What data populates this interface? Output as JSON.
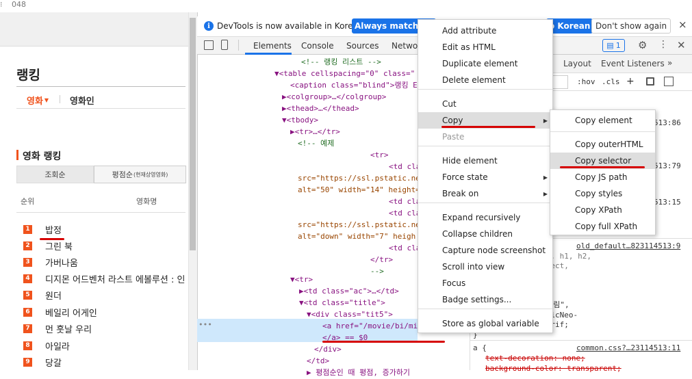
{
  "top_strip": {
    "dots": "⁝",
    "number": "048"
  },
  "left": {
    "page_title": "랭킹",
    "tabs": [
      {
        "label": "영화"
      },
      {
        "label": "영화인"
      }
    ],
    "section_title": "영화 랭킹",
    "sort_buttons": [
      {
        "label": "조회순"
      },
      {
        "label": "평점순",
        "sub": "(현재상영영화)"
      }
    ],
    "columns": {
      "rank": "순위",
      "movie": "영화명"
    },
    "rows": [
      {
        "rank": "1",
        "title": "밥정"
      },
      {
        "rank": "2",
        "title": "그린 북"
      },
      {
        "rank": "3",
        "title": "가버나움"
      },
      {
        "rank": "4",
        "title": "디지몬 어드벤처 라스트 에볼루션 : 인"
      },
      {
        "rank": "5",
        "title": "원더"
      },
      {
        "rank": "6",
        "title": "베일리 어게인"
      },
      {
        "rank": "7",
        "title": "먼 훗날 우리"
      },
      {
        "rank": "8",
        "title": "아일라"
      },
      {
        "rank": "9",
        "title": "당갈"
      }
    ]
  },
  "devtools": {
    "info_text": "DevTools is now available in Korean!",
    "btn_match": "Always match Ch",
    "btn_switch": "o Korean",
    "btn_dont_show": "Don't show again",
    "close": "×",
    "tabs": [
      "Elements",
      "Console",
      "Sources",
      "Networ"
    ],
    "badge_count": "1",
    "side_tabs": [
      "Layout",
      "Event Listeners",
      "»"
    ],
    "styles_toolbar": [
      ":hov",
      ".cls",
      "+"
    ],
    "dom_lines": [
      "<!-- 랭킹 리스트 -->",
      "▼<table cellspacing=\"0\" class=\"",
      "<caption class=\"blind\">랭킹 E",
      "▶<colgroup>…</colgroup>",
      "▶<thead>…</thead>",
      "▼<tbody>",
      "▶<tr>…</tr>",
      "<!-- 예제",
      "<tr>",
      "<td cla",
      "src=\"https://ssl.pstatic.ne",
      "alt=\"50\" width=\"14\" height=",
      "<td cla",
      "<td cla",
      "src=\"https://ssl.pstatic.ne",
      "alt=\"down\" width=\"7\" heigh",
      "<td cla",
      "</tr>",
      "-->",
      "▼<tr>",
      "▶<td class=\"ac\">…</td>",
      "▼<td class=\"title\">",
      "▼<div class=\"tit5\">",
      "<a href=\"/movie/bi/mi",
      "</a> == $0",
      "</div>",
      "</td>",
      "▶ 평점순인 때 평점, 증가하기"
    ],
    "styles_lines": [
      "513:86",
      "513:79",
      "513:15",
      "old_default…823114513:9",
      ", dl, dt, dd, a, h1, h2,",
      "orm, input, select,",
      ", legend, img {",
      "rmal;",
      "돌움\", Dotum, \"굴림\",",
      "ica,AppleSDGothicNeo-",
      "Gothic, Sans-serif;",
      "}",
      "common.css?…23114513:11",
      "a {",
      "text-decoration: none;",
      "background-color: transparent;"
    ],
    "dom_hover_dots": "•••"
  },
  "context_menu": {
    "items": [
      {
        "label": "Add attribute"
      },
      {
        "label": "Edit as HTML"
      },
      {
        "label": "Duplicate element"
      },
      {
        "label": "Delete element"
      },
      {
        "label": "Cut"
      },
      {
        "label": "Copy",
        "arrow": "▶"
      },
      {
        "label": "Paste"
      },
      {
        "label": "Hide element"
      },
      {
        "label": "Force state",
        "arrow": "▶"
      },
      {
        "label": "Break on",
        "arrow": "▶"
      },
      {
        "label": "Expand recursively"
      },
      {
        "label": "Collapse children"
      },
      {
        "label": "Capture node screenshot"
      },
      {
        "label": "Scroll into view"
      },
      {
        "label": "Focus"
      },
      {
        "label": "Badge settings..."
      },
      {
        "label": "Store as global variable"
      }
    ]
  },
  "submenu": {
    "items": [
      {
        "label": "Copy element"
      },
      {
        "label": "Copy outerHTML"
      },
      {
        "label": "Copy selector"
      },
      {
        "label": "Copy JS path"
      },
      {
        "label": "Copy styles"
      },
      {
        "label": "Copy XPath"
      },
      {
        "label": "Copy full XPath"
      }
    ]
  },
  "colors": {
    "accent_orange": "#f0531d",
    "devtools_blue": "#1a73e8",
    "annotation_red": "#d60000",
    "tag": "#881280",
    "attr": "#994500",
    "value": "#1a1aa6",
    "comment": "#236e25"
  }
}
